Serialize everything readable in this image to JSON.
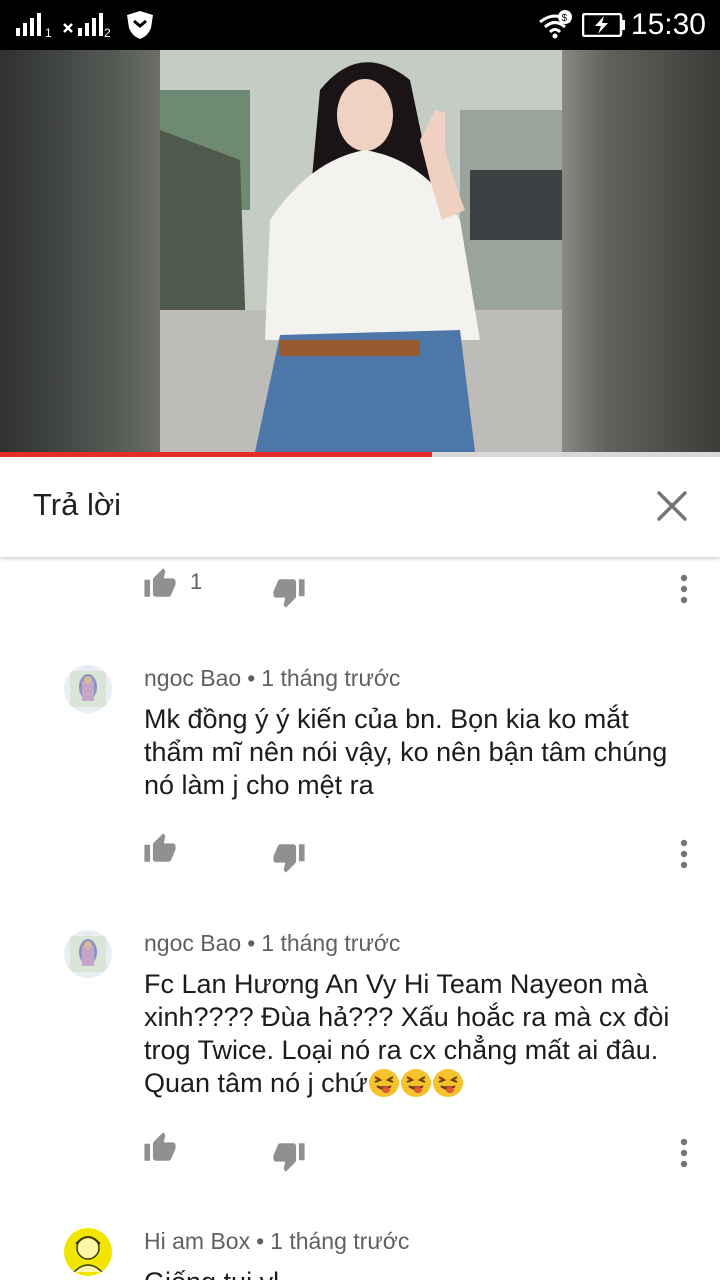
{
  "status_bar": {
    "time": "15:30",
    "sim1_label": "1",
    "sim2_label": "2"
  },
  "video": {
    "progress_fraction": 0.6
  },
  "reply_header": {
    "title": "Trả lời"
  },
  "first_action_row": {
    "like_count": "1"
  },
  "comments": [
    {
      "author": "ngoc Bao",
      "separator": "•",
      "time": "1 tháng trước",
      "text": "Mk đồng ý ý kiến của bn. Bọn kia ko mắt thẩm mĩ nên nói vậy, ko nên bận tâm chúng nó làm j cho mệt ra",
      "emojis": []
    },
    {
      "author": "ngoc Bao",
      "separator": "•",
      "time": "1 tháng trước",
      "text": "Fc Lan Hương An Vy Hi Team Nayeon mà xinh???? Đùa hả??? Xấu hoắc ra mà cx đòi trog Twice. Loại nó ra cx chẳng mất ai đâu. Quan tâm nó j chứ",
      "emojis": [
        "squinting-tongue-face",
        "squinting-tongue-face",
        "squinting-tongue-face"
      ]
    },
    {
      "author": "Hi am Box",
      "separator": "•",
      "time": "1 tháng trước",
      "text": "Giống tui vl",
      "emojis": []
    }
  ],
  "icons": {
    "like": "thumb-up-icon",
    "dislike": "thumb-down-icon",
    "more": "more-vert-icon",
    "close": "close-icon"
  },
  "colors": {
    "accent": "#e52d27",
    "meta_text": "#606060",
    "icon_gray": "#909090",
    "status_bar": "#000000"
  }
}
